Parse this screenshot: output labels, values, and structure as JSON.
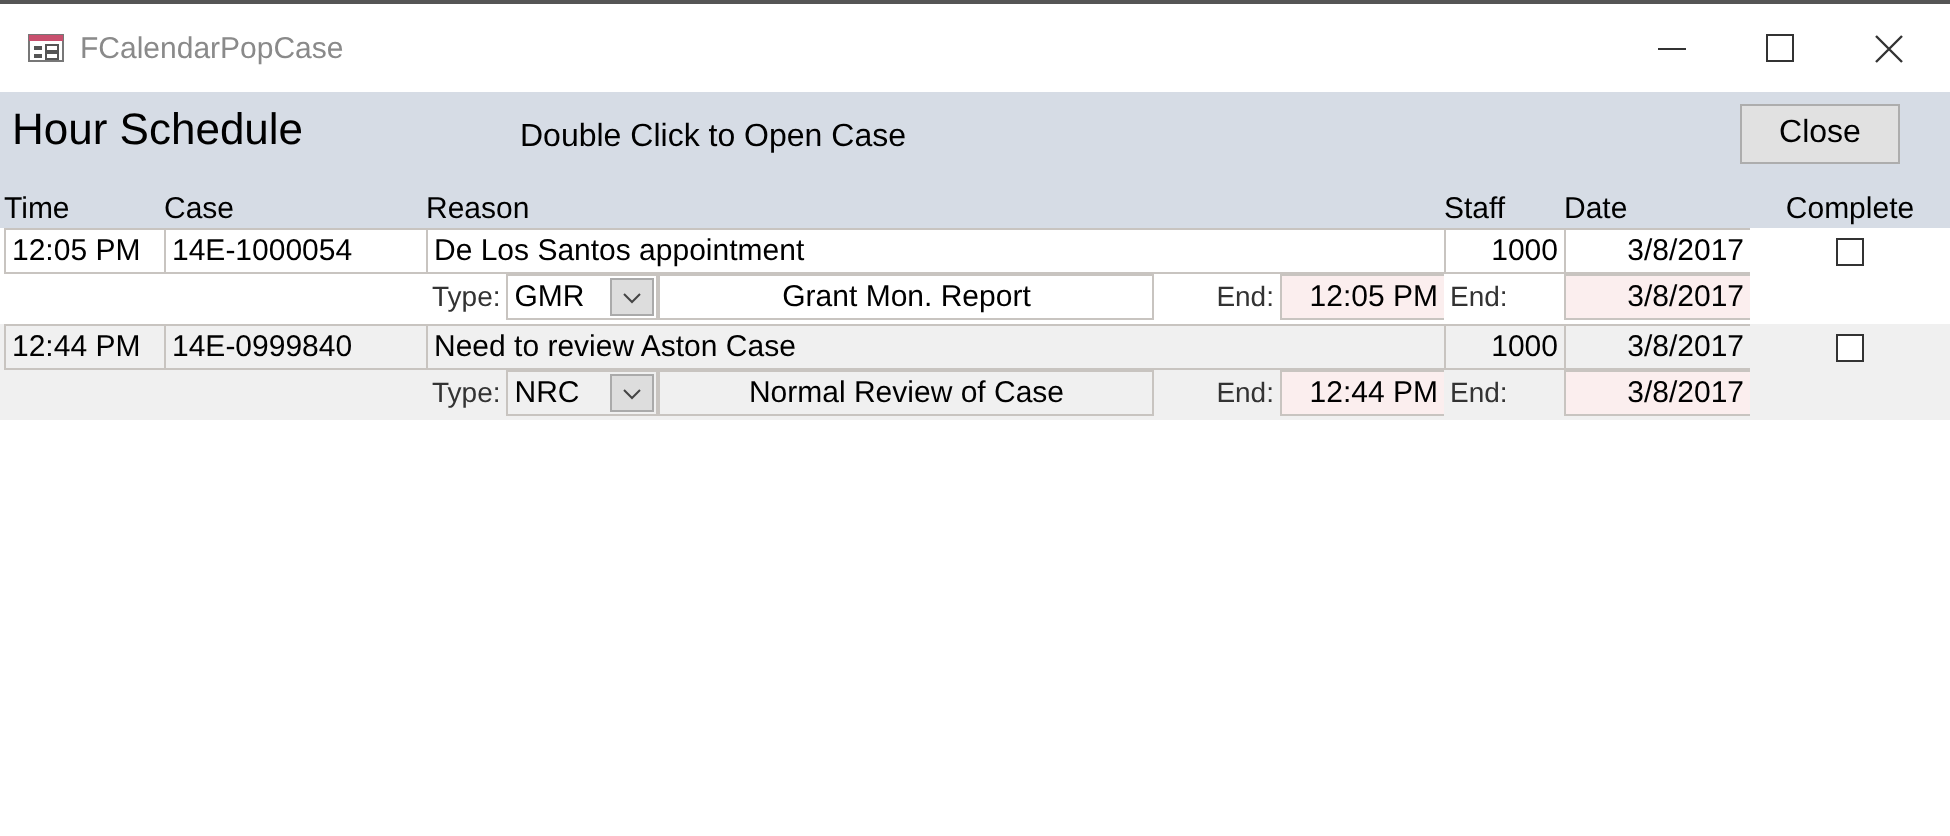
{
  "window": {
    "title": "FCalendarPopCase"
  },
  "header": {
    "title": "Hour Schedule",
    "hint": "Double Click to Open Case",
    "close_button": "Close"
  },
  "columns": [
    "Time",
    "Case",
    "Reason",
    "Staff",
    "Date",
    "Complete"
  ],
  "records": [
    {
      "time": "12:05 PM",
      "case": "14E-1000054",
      "reason": "De Los Santos appointment",
      "staff": "1000",
      "date": "3/8/2017",
      "complete": false,
      "type_label": "Type:",
      "type": "GMR",
      "type_desc": "Grant Mon. Report",
      "end_label": "End:",
      "end_time": "12:05 PM",
      "end_date_label": "End:",
      "end_date": "3/8/2017"
    },
    {
      "time": "12:44 PM",
      "case": "14E-0999840",
      "reason": "Need to review Aston Case",
      "staff": "1000",
      "date": "3/8/2017",
      "complete": false,
      "type_label": "Type:",
      "type": "NRC",
      "type_desc": "Normal Review of Case",
      "end_label": "End:",
      "end_time": "12:44 PM",
      "end_date_label": "End:",
      "end_date": "3/8/2017"
    }
  ]
}
